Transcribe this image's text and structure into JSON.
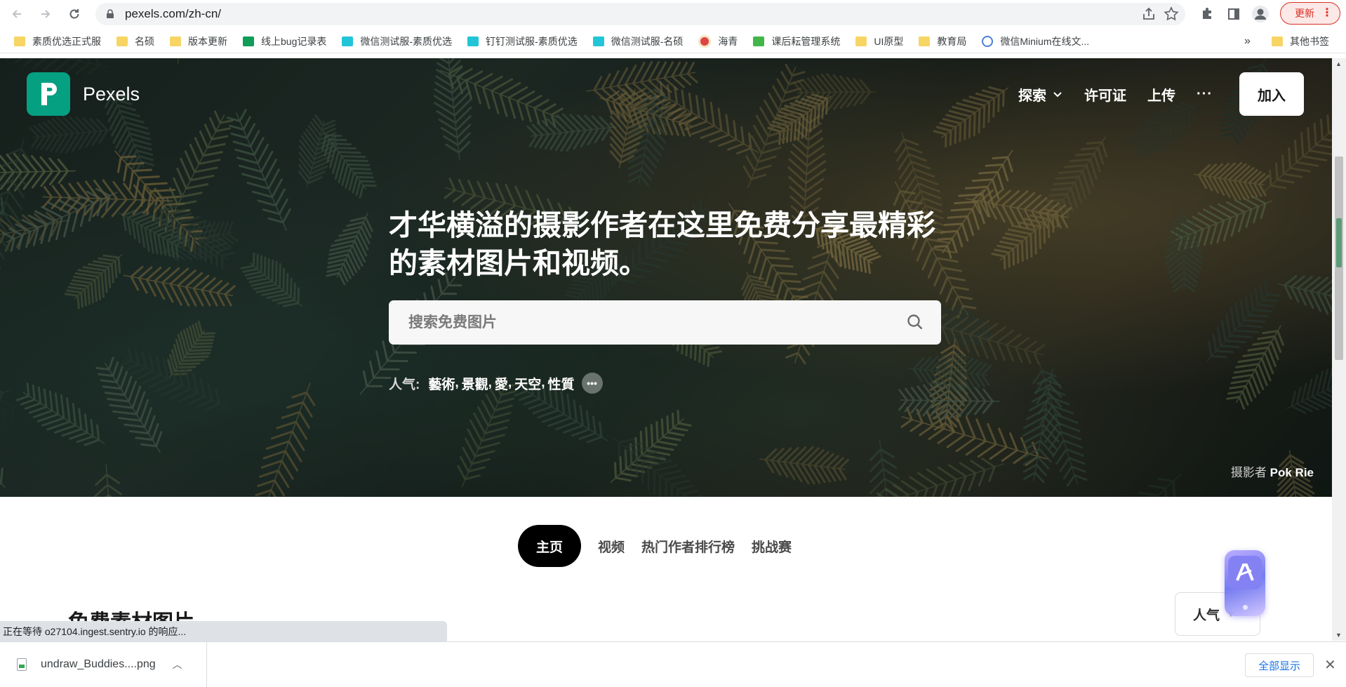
{
  "browser": {
    "url": "pexels.com/zh-cn/",
    "update_label": "更新",
    "bookmarks": [
      {
        "label": "素质优选正式服",
        "icon": "folder-icon"
      },
      {
        "label": "名硕",
        "icon": "folder-icon"
      },
      {
        "label": "版本更新",
        "icon": "folder-icon"
      },
      {
        "label": "线上bug记录表",
        "icon": "sheet-icon"
      },
      {
        "label": "微信测试服-素质优选",
        "icon": "u-icon"
      },
      {
        "label": "钉钉测试服-素质优选",
        "icon": "u-icon"
      },
      {
        "label": "微信测试服-名硕",
        "icon": "u-icon"
      },
      {
        "label": "海青",
        "icon": "seal-icon"
      },
      {
        "label": "课后耘管理系统",
        "icon": "app-icon"
      },
      {
        "label": "UI原型",
        "icon": "folder-icon"
      },
      {
        "label": "教育局",
        "icon": "folder-icon"
      },
      {
        "label": "微信Minium在线文...",
        "icon": "doc-icon"
      }
    ],
    "bookmarks_overflow": "»",
    "other_bookmarks": "其他书签"
  },
  "hero": {
    "brand": "Pexels",
    "nav": {
      "explore": "探索",
      "license": "许可证",
      "upload": "上传",
      "more": "···",
      "join": "加入"
    },
    "headline_line1": "才华横溢的摄影作者在这里免费分享最精彩",
    "headline_line2": "的素材图片和视频。",
    "search_placeholder": "搜索免费图片",
    "popular_label": "人气:",
    "popular_tags": [
      "藝術",
      "景觀",
      "愛",
      "天空",
      "性質"
    ],
    "credit_prefix": "摄影者",
    "credit_name": "Pok Rie"
  },
  "tabs": [
    "主页",
    "视频",
    "热门作者排行榜",
    "挑战赛"
  ],
  "section_title": "免费素材图片",
  "sort_label": "人气",
  "status_text": "正在等待 o27104.ingest.sentry.io 的响应...",
  "download": {
    "filename": "undraw_Buddies....png",
    "show_all": "全部显示"
  },
  "colors": {
    "brand_green": "#05a081",
    "update_red": "#d93025",
    "link_blue": "#1a73e8"
  }
}
